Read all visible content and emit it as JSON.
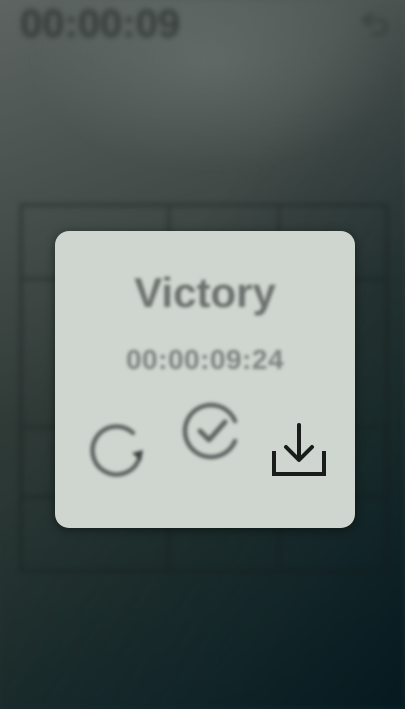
{
  "status": {
    "elapsed_time": "00:00:09"
  },
  "result_dialog": {
    "title": "Victory",
    "final_time": "00:00:09:24"
  },
  "icons": {
    "undo": "undo-icon",
    "restart": "restart-icon",
    "confirm": "check-circle-icon",
    "download": "download-icon"
  },
  "colors": {
    "dialog_bg": "#cfd6cf",
    "dialog_text": "#6d716e",
    "icon_dark": "#1a1c1b"
  }
}
